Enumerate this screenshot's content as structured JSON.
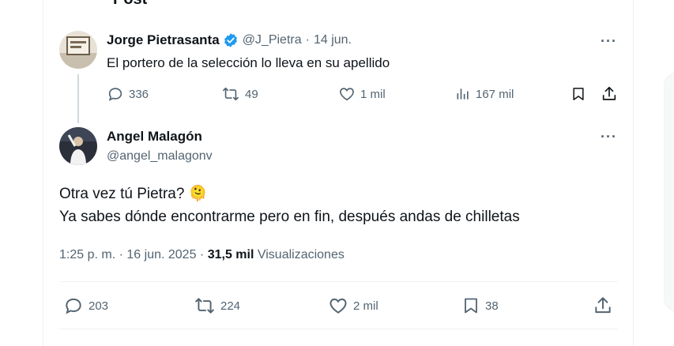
{
  "header": {
    "cutoff_text": "Post"
  },
  "quoted_tweet": {
    "author_name": "Jorge Pietrasanta",
    "handle": "@J_Pietra",
    "separator": "·",
    "date": "14 jun.",
    "text": "El portero de la selección lo lleva en su apellido",
    "replies": "336",
    "retweets": "49",
    "likes": "1 mil",
    "views": "167 mil",
    "more": "···"
  },
  "main_tweet": {
    "author_name": "Angel Malagón",
    "handle": "@angel_malagonv",
    "line1": "Otra vez tú Pietra? 🫠",
    "line2": "Ya sabes dónde encontrarme pero en fin, después andas de chilletas",
    "time": "1:25 p. m.",
    "separator": "·",
    "date": "16 jun. 2025",
    "separator2": "·",
    "views_count": "31,5 mil",
    "views_label": "Visualizaciones",
    "replies": "203",
    "retweets": "224",
    "likes": "2 mil",
    "bookmarks": "38",
    "more": "···"
  },
  "colors": {
    "text": "#0f1419",
    "secondary": "#536471",
    "verified": "#1d9bf0",
    "line": "#cfd9de"
  }
}
